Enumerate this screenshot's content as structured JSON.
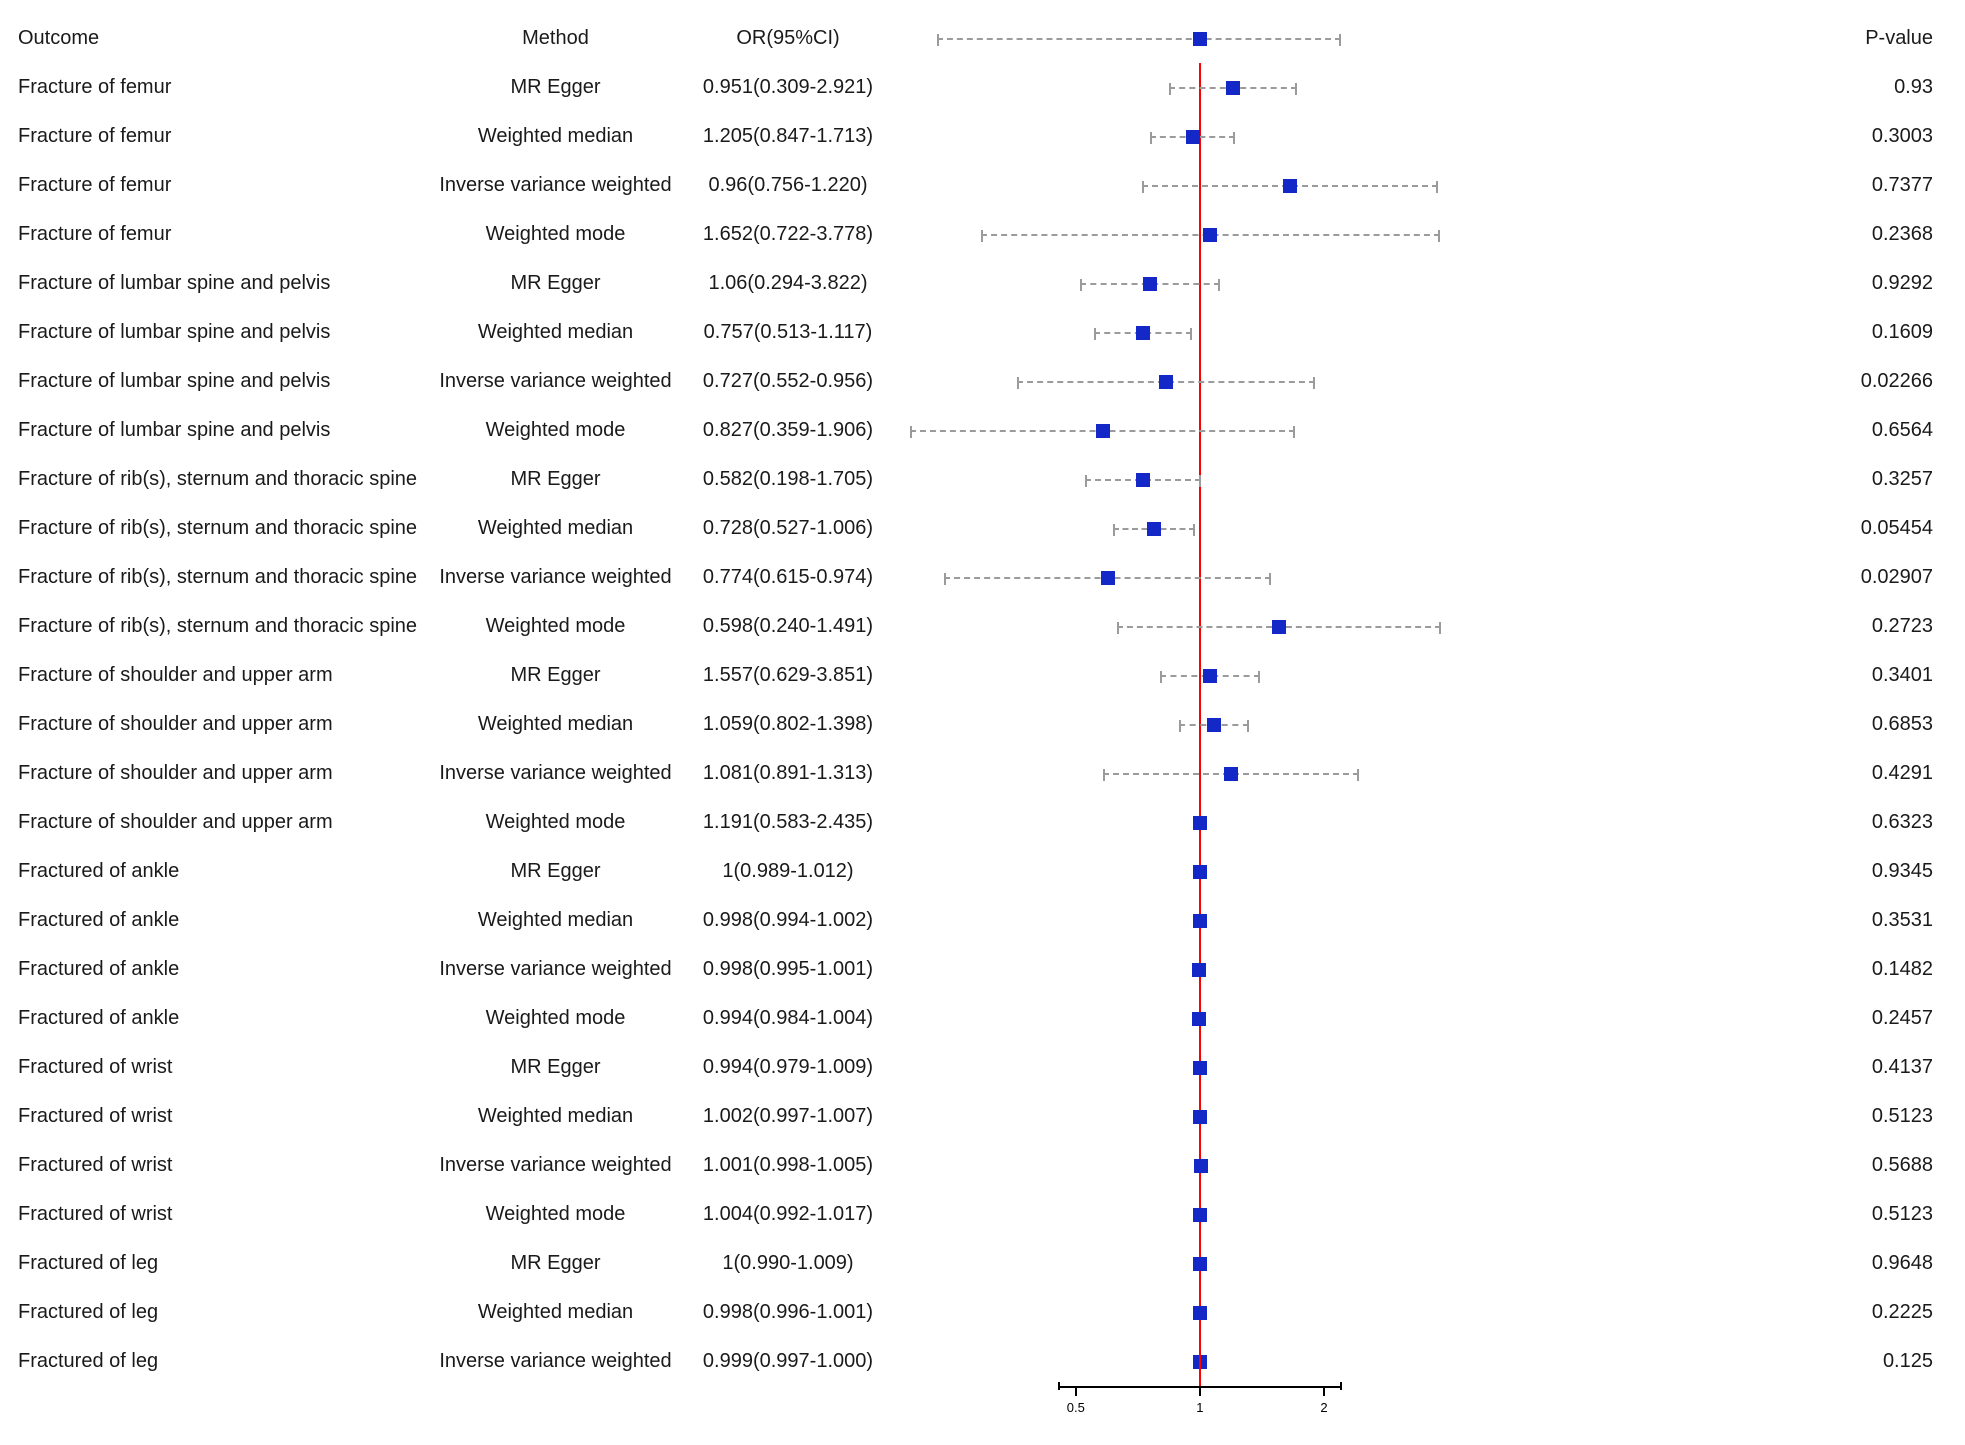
{
  "headers": {
    "outcome": "Outcome",
    "method": "Method",
    "or": "OR(95%CI)",
    "pvalue": "P-value"
  },
  "chart_data": {
    "type": "forest-plot",
    "xscale": "log",
    "xlim": [
      0.18,
      4.0
    ],
    "refline": 1,
    "axis_ticks": [
      0.5,
      1,
      2
    ],
    "header_ci": {
      "lo": 0.23,
      "hi": 2.2,
      "or": 1.0
    },
    "rows": [
      {
        "outcome": "Fracture of femur",
        "method": "MR Egger",
        "or": 0.951,
        "lo": 0.309,
        "hi": 2.921,
        "ci_text": "0.951(0.309-2.921)",
        "pvalue": "0.93",
        "disp": {
          "or": 1.2,
          "lo": 0.84,
          "hi": 1.72
        }
      },
      {
        "outcome": "Fracture of femur",
        "method": "Weighted median",
        "or": 1.205,
        "lo": 0.847,
        "hi": 1.713,
        "ci_text": "1.205(0.847-1.713)",
        "pvalue": "0.3003",
        "disp": {
          "or": 0.96,
          "lo": 0.756,
          "hi": 1.22
        }
      },
      {
        "outcome": "Fracture of femur",
        "method": "Inverse variance weighted",
        "or": 0.96,
        "lo": 0.756,
        "hi": 1.22,
        "ci_text": "0.96(0.756-1.220)",
        "pvalue": "0.7377",
        "disp": {
          "or": 1.65,
          "lo": 0.722,
          "hi": 3.78
        }
      },
      {
        "outcome": "Fracture of femur",
        "method": "Weighted mode",
        "or": 1.652,
        "lo": 0.722,
        "hi": 3.778,
        "ci_text": "1.652(0.722-3.778)",
        "pvalue": "0.2368",
        "disp": {
          "or": 1.06,
          "lo": 0.294,
          "hi": 3.82
        }
      },
      {
        "outcome": "Fracture of lumbar spine and pelvis",
        "method": "MR Egger",
        "or": 1.06,
        "lo": 0.294,
        "hi": 3.822,
        "ci_text": "1.06(0.294-3.822)",
        "pvalue": "0.9292",
        "disp": {
          "or": 0.757,
          "lo": 0.513,
          "hi": 1.117
        }
      },
      {
        "outcome": "Fracture of lumbar spine and pelvis",
        "method": "Weighted median",
        "or": 0.757,
        "lo": 0.513,
        "hi": 1.117,
        "ci_text": "0.757(0.513-1.117)",
        "pvalue": "0.1609",
        "disp": {
          "or": 0.727,
          "lo": 0.552,
          "hi": 0.956
        }
      },
      {
        "outcome": "Fracture of lumbar spine and pelvis",
        "method": "Inverse variance weighted",
        "or": 0.727,
        "lo": 0.552,
        "hi": 0.956,
        "ci_text": "0.727(0.552-0.956)",
        "pvalue": "0.02266",
        "disp": {
          "or": 0.827,
          "lo": 0.359,
          "hi": 1.906
        }
      },
      {
        "outcome": "Fracture of lumbar spine and pelvis",
        "method": "Weighted mode",
        "or": 0.827,
        "lo": 0.359,
        "hi": 1.906,
        "ci_text": "0.827(0.359-1.906)",
        "pvalue": "0.6564",
        "disp": {
          "or": 0.582,
          "lo": 0.198,
          "hi": 1.705
        }
      },
      {
        "outcome": "Fracture of rib(s), sternum and thoracic spine",
        "method": "MR Egger",
        "or": 0.582,
        "lo": 0.198,
        "hi": 1.705,
        "ci_text": "0.582(0.198-1.705)",
        "pvalue": "0.3257",
        "disp": {
          "or": 0.728,
          "lo": 0.527,
          "hi": 1.006
        }
      },
      {
        "outcome": "Fracture of rib(s), sternum and thoracic spine",
        "method": "Weighted median",
        "or": 0.728,
        "lo": 0.527,
        "hi": 1.006,
        "ci_text": "0.728(0.527-1.006)",
        "pvalue": "0.05454",
        "disp": {
          "or": 0.774,
          "lo": 0.615,
          "hi": 0.974
        }
      },
      {
        "outcome": "Fracture of rib(s), sternum and thoracic spine",
        "method": "Inverse variance weighted",
        "or": 0.774,
        "lo": 0.615,
        "hi": 0.974,
        "ci_text": "0.774(0.615-0.974)",
        "pvalue": "0.02907",
        "disp": {
          "or": 0.598,
          "lo": 0.24,
          "hi": 1.491
        }
      },
      {
        "outcome": "Fracture of rib(s), sternum and thoracic spine",
        "method": "Weighted mode",
        "or": 0.598,
        "lo": 0.24,
        "hi": 1.491,
        "ci_text": "0.598(0.240-1.491)",
        "pvalue": "0.2723",
        "disp": {
          "or": 1.557,
          "lo": 0.629,
          "hi": 3.851
        }
      },
      {
        "outcome": "Fracture of shoulder and upper arm",
        "method": "MR Egger",
        "or": 1.557,
        "lo": 0.629,
        "hi": 3.851,
        "ci_text": "1.557(0.629-3.851)",
        "pvalue": "0.3401",
        "disp": {
          "or": 1.059,
          "lo": 0.802,
          "hi": 1.398
        }
      },
      {
        "outcome": "Fracture of shoulder and upper arm",
        "method": "Weighted median",
        "or": 1.059,
        "lo": 0.802,
        "hi": 1.398,
        "ci_text": "1.059(0.802-1.398)",
        "pvalue": "0.6853",
        "disp": {
          "or": 1.081,
          "lo": 0.891,
          "hi": 1.313
        }
      },
      {
        "outcome": "Fracture of shoulder and upper arm",
        "method": "Inverse variance weighted",
        "or": 1.081,
        "lo": 0.891,
        "hi": 1.313,
        "ci_text": "1.081(0.891-1.313)",
        "pvalue": "0.4291",
        "disp": {
          "or": 1.191,
          "lo": 0.583,
          "hi": 2.435
        }
      },
      {
        "outcome": "Fracture of shoulder and upper arm",
        "method": "Weighted mode",
        "or": 1.191,
        "lo": 0.583,
        "hi": 2.435,
        "ci_text": "1.191(0.583-2.435)",
        "pvalue": "0.6323",
        "disp": {
          "or": 1,
          "lo": 0.989,
          "hi": 1.012
        }
      },
      {
        "outcome": "Fractured of ankle",
        "method": "MR Egger",
        "or": 1,
        "lo": 0.989,
        "hi": 1.012,
        "ci_text": "1(0.989-1.012)",
        "pvalue": "0.9345",
        "disp": {
          "or": 0.998,
          "lo": 0.994,
          "hi": 1.002
        }
      },
      {
        "outcome": "Fractured of ankle",
        "method": "Weighted median",
        "or": 0.998,
        "lo": 0.994,
        "hi": 1.002,
        "ci_text": "0.998(0.994-1.002)",
        "pvalue": "0.3531",
        "disp": {
          "or": 0.998,
          "lo": 0.995,
          "hi": 1.001
        }
      },
      {
        "outcome": "Fractured of ankle",
        "method": "Inverse variance weighted",
        "or": 0.998,
        "lo": 0.995,
        "hi": 1.001,
        "ci_text": "0.998(0.995-1.001)",
        "pvalue": "0.1482",
        "disp": {
          "or": 0.994,
          "lo": 0.984,
          "hi": 1.004
        }
      },
      {
        "outcome": "Fractured of ankle",
        "method": "Weighted mode",
        "or": 0.994,
        "lo": 0.984,
        "hi": 1.004,
        "ci_text": "0.994(0.984-1.004)",
        "pvalue": "0.2457",
        "disp": {
          "or": 0.994,
          "lo": 0.979,
          "hi": 1.009
        }
      },
      {
        "outcome": "Fractured of wrist",
        "method": "MR Egger",
        "or": 0.994,
        "lo": 0.979,
        "hi": 1.009,
        "ci_text": "0.994(0.979-1.009)",
        "pvalue": "0.4137",
        "disp": {
          "or": 1.002,
          "lo": 0.997,
          "hi": 1.007
        }
      },
      {
        "outcome": "Fractured of wrist",
        "method": "Weighted median",
        "or": 1.002,
        "lo": 0.997,
        "hi": 1.007,
        "ci_text": "1.002(0.997-1.007)",
        "pvalue": "0.5123",
        "disp": {
          "or": 1.001,
          "lo": 0.998,
          "hi": 1.005
        }
      },
      {
        "outcome": "Fractured of wrist",
        "method": "Inverse variance weighted",
        "or": 1.001,
        "lo": 0.998,
        "hi": 1.005,
        "ci_text": "1.001(0.998-1.005)",
        "pvalue": "0.5688",
        "disp": {
          "or": 1.004,
          "lo": 0.992,
          "hi": 1.017
        }
      },
      {
        "outcome": "Fractured of wrist",
        "method": "Weighted mode",
        "or": 1.004,
        "lo": 0.992,
        "hi": 1.017,
        "ci_text": "1.004(0.992-1.017)",
        "pvalue": "0.5123",
        "disp": {
          "or": 1,
          "lo": 0.99,
          "hi": 1.009
        }
      },
      {
        "outcome": "Fractured of leg",
        "method": "MR Egger",
        "or": 1,
        "lo": 0.99,
        "hi": 1.009,
        "ci_text": "1(0.990-1.009)",
        "pvalue": "0.9648",
        "disp": {
          "or": 0.998,
          "lo": 0.996,
          "hi": 1.001
        }
      },
      {
        "outcome": "Fractured of leg",
        "method": "Weighted median",
        "or": 0.998,
        "lo": 0.996,
        "hi": 1.001,
        "ci_text": "0.998(0.996-1.001)",
        "pvalue": "0.2225",
        "disp": {
          "or": 0.999,
          "lo": 0.997,
          "hi": 1.0
        }
      },
      {
        "outcome": "Fractured of leg",
        "method": "Inverse variance weighted",
        "or": 0.999,
        "lo": 0.997,
        "hi": 1.0,
        "ci_text": "0.999(0.997-1.000)",
        "pvalue": "0.125",
        "disp": {
          "or": 0.999,
          "lo": 0.997,
          "hi": 1.0
        }
      }
    ]
  }
}
